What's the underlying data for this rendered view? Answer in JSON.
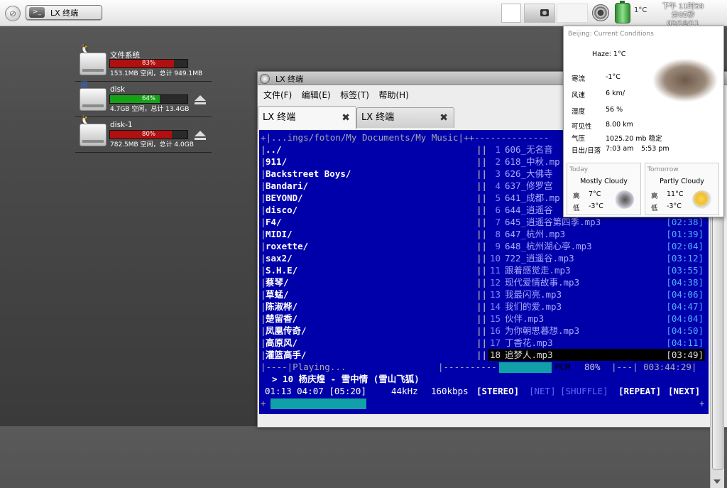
{
  "panel": {
    "menu_icon": "launcher-icon",
    "task_button_label": "LX 终端",
    "temperature": "1°C",
    "clock_line1": "下午 11时59分05秒",
    "clock_line2": "02/18/11"
  },
  "drives": [
    {
      "name": "文件系统",
      "os_icon": "linux-tux-icon",
      "percent": 83,
      "percent_label": "83%",
      "bar_color": "#b01010",
      "info": "153.1MB 空闲，总计 949.1MB",
      "eject": false
    },
    {
      "name": "disk",
      "os_icon": "windows-logo-icon",
      "percent": 64,
      "percent_label": "64%",
      "bar_color": "#18a018",
      "info": "4.7GB 空闲，总计 13.4GB",
      "eject": true
    },
    {
      "name": "disk-1",
      "os_icon": "linux-tux-icon",
      "percent": 80,
      "percent_label": "80%",
      "bar_color": "#b01010",
      "info": "782.5MB 空闲，总计 4.0GB",
      "eject": true
    }
  ],
  "terminal": {
    "title": "LX 终端",
    "menu": [
      "文件(F)",
      "编辑(E)",
      "标签(T)",
      "帮助(H)"
    ],
    "tabs": [
      {
        "label": "LX 终端",
        "close": "✖"
      },
      {
        "label": "LX 终端",
        "close": "✖"
      }
    ],
    "path_line": "+|...ings/foton/My Documents/My Music|++--------------",
    "dirs": [
      "../",
      "911/",
      "Backstreet Boys/",
      "Bandari/",
      "BEYOND/",
      "disco/",
      "F4/",
      "MIDI/",
      "roxette/",
      "sax2/",
      "S.H.E/",
      "蔡琴/",
      "草蜢/",
      "陈淑桦/",
      "楚留香/",
      "凤凰传奇/",
      "高原风/",
      "灌篮高手/"
    ],
    "tracks": [
      {
        "num": "1",
        "name": "606_无名音",
        "time": ""
      },
      {
        "num": "2",
        "name": "618_中秋.mp",
        "time": ""
      },
      {
        "num": "3",
        "name": "626_大佛寺",
        "time": ""
      },
      {
        "num": "4",
        "name": "637_修罗宫",
        "time": ""
      },
      {
        "num": "5",
        "name": "641_成都.mp",
        "time": ""
      },
      {
        "num": "6",
        "name": "644_逍遥谷",
        "time": ""
      },
      {
        "num": "7",
        "name": "645_逍遥谷第四季.mp3",
        "time": "[02:38]"
      },
      {
        "num": "8",
        "name": "647_杭州.mp3",
        "time": "[01:39]"
      },
      {
        "num": "9",
        "name": "648_杭州湖心亭.mp3",
        "time": "[02:04]"
      },
      {
        "num": "10",
        "name": "722_逍遥谷.mp3",
        "time": "[03:12]"
      },
      {
        "num": "11",
        "name": "跟着感觉走.mp3",
        "time": "[03:55]"
      },
      {
        "num": "12",
        "name": "现代爱情故事.mp3",
        "time": "[04:38]"
      },
      {
        "num": "13",
        "name": "我最闪亮.mp3",
        "time": "[04:06]"
      },
      {
        "num": "14",
        "name": "我们的爱.mp3",
        "time": "[04:47]"
      },
      {
        "num": "15",
        "name": "伙伴.mp3",
        "time": "[04:04]"
      },
      {
        "num": "16",
        "name": "为你朝思暮想.mp3",
        "time": "[04:50]"
      },
      {
        "num": "17",
        "name": "丁香花.mp3",
        "time": "[04:11]"
      },
      {
        "num": "18",
        "name": "追梦人.mp3",
        "time": "[03:49]"
      }
    ],
    "status_left": "|----|Playing...",
    "status_dashes": "|----------",
    "pcm_label": "PCM",
    "volume": "80%",
    "volume_fraction": 0.8,
    "status_right": "|---| 003:44:29|",
    "now_playing": "> 10 杨庆煌 - 雪中情 (雪山飞狐)",
    "time_line": "01:13 04:07 [05:20]",
    "freq": "44kHz",
    "bitrate": "160kbps",
    "flags": {
      "stereo": "[STEREO]",
      "net": "[NET]",
      "shuffle": "[SHUFFLE]",
      "repeat": "[REPEAT]",
      "next": "[NEXT]"
    },
    "progress_fraction": 0.45
  },
  "weather": {
    "header": "Beijing: Current Conditions",
    "haze": "Haze: 1°C",
    "rows": [
      {
        "k": "寒流",
        "v": "-1°C",
        "v2": ""
      },
      {
        "k": "风速",
        "v": "6 km/",
        "v2": ""
      },
      {
        "k": "湿度",
        "v": "56 %",
        "v2": ""
      },
      {
        "k": "可见性",
        "v": "8.00 km",
        "v2": ""
      },
      {
        "k": "气压",
        "v": "1025.20 mb 稳定",
        "v2": ""
      },
      {
        "k": "日出/日落",
        "v": "7:03 am",
        "v2": "5:53 pm"
      }
    ],
    "today": {
      "label": "Today",
      "cond": "Mostly Cloudy",
      "high_k": "高",
      "high": "7°C",
      "low_k": "低",
      "low": "-3°C",
      "icon": "mostly-cloudy-icon"
    },
    "tomorrow": {
      "label": "Tomorrow",
      "cond": "Partly Cloudy",
      "high_k": "高",
      "high": "11°C",
      "low_k": "低",
      "low": "-3°C",
      "icon": "partly-cloudy-icon"
    }
  }
}
